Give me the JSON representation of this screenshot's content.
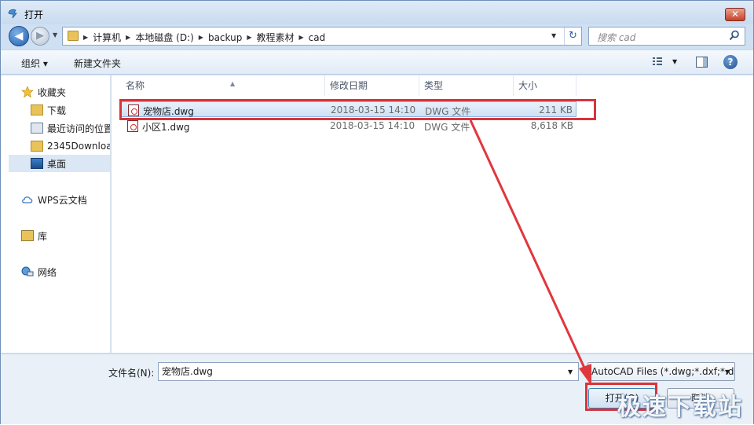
{
  "window": {
    "title": "打开",
    "close_symbol": "✕"
  },
  "address": {
    "crumbs": [
      "计算机",
      "本地磁盘 (D:)",
      "backup",
      "教程素材",
      "cad"
    ],
    "search_placeholder": "搜索 cad"
  },
  "toolbar": {
    "organize_label": "组织 ▾",
    "new_folder_label": "新建文件夹",
    "help_symbol": "?"
  },
  "sidebar": {
    "items": [
      {
        "label": "收藏夹",
        "icon": "star-icon"
      },
      {
        "label": "下载",
        "icon": "folder-icon"
      },
      {
        "label": "最近访问的位置",
        "icon": "recent-places-icon"
      },
      {
        "label": "2345Downloa",
        "icon": "folder-icon"
      },
      {
        "label": "桌面",
        "icon": "desktop-icon"
      },
      {
        "label": "WPS云文档",
        "icon": "cloud-icon"
      },
      {
        "label": "库",
        "icon": "library-icon"
      },
      {
        "label": "网络",
        "icon": "network-icon"
      }
    ]
  },
  "columns": {
    "name": "名称",
    "date": "修改日期",
    "type": "类型",
    "size": "大小"
  },
  "files": [
    {
      "name": "宠物店.dwg",
      "date": "2018-03-15 14:10",
      "type": "DWG 文件",
      "size": "211 KB",
      "selected": true
    },
    {
      "name": "小区1.dwg",
      "date": "2018-03-15 14:10",
      "type": "DWG 文件",
      "size": "8,618 KB",
      "selected": false
    }
  ],
  "bottom": {
    "filename_label": "文件名(N):",
    "filename_value": "宠物店.dwg",
    "filetype_value": "AutoCAD Files (*.dwg;*.dxf;*.dws;*.dwt)",
    "open_label": "打开(O)",
    "cancel_label": "取消"
  },
  "watermark": "极速下载站",
  "colors": {
    "highlight": "#d8343a",
    "selection": "#cfe1f5",
    "chrome": "#cfe0f3"
  }
}
